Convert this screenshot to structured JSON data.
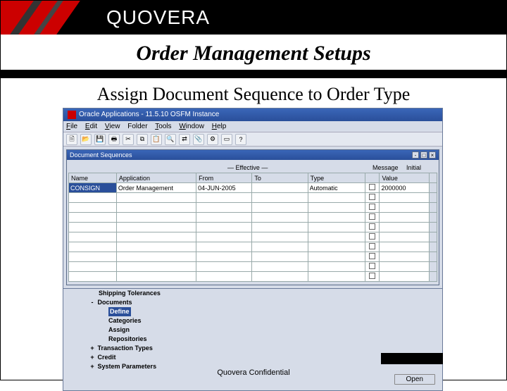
{
  "brand": "QUOVERA",
  "title": "Order Management Setups",
  "subtitle": "Assign Document Sequence to Order Type",
  "app": {
    "window_title": "Oracle Applications - 11.5.10 OSFM Instance",
    "menus": [
      "File",
      "Edit",
      "View",
      "Folder",
      "Tools",
      "Window",
      "Help"
    ],
    "inner_title": "Document Sequences",
    "effective_label": "Effective",
    "message_label": "Message",
    "columns": [
      "Name",
      "Application",
      "From",
      "To",
      "Type",
      "",
      "Initial Value"
    ],
    "col_initial_value_top": "Initial",
    "col_initial_value_bottom": "Value",
    "rows": [
      {
        "name": "CONSIGN",
        "application": "Order Management",
        "from": "04-JUN-2005",
        "to": "",
        "type": "Automatic",
        "msg": false,
        "initial": "2000000"
      }
    ],
    "blank_rows": 9
  },
  "nav": {
    "items": [
      {
        "level": 1,
        "label": "Shipping Tolerances",
        "prefix": ""
      },
      {
        "level": 0,
        "label": "Documents",
        "prefix": "-"
      },
      {
        "level": 2,
        "label": "Define",
        "selected": true
      },
      {
        "level": 2,
        "label": "Categories"
      },
      {
        "level": 2,
        "label": "Assign"
      },
      {
        "level": 2,
        "label": "Repositories"
      },
      {
        "level": 0,
        "label": "Transaction Types",
        "prefix": "+"
      },
      {
        "level": 0,
        "label": "Credit",
        "prefix": "+"
      },
      {
        "level": 0,
        "label": "System Parameters",
        "prefix": "+"
      }
    ],
    "open_label": "Open"
  },
  "footer": "Quovera Confidential"
}
